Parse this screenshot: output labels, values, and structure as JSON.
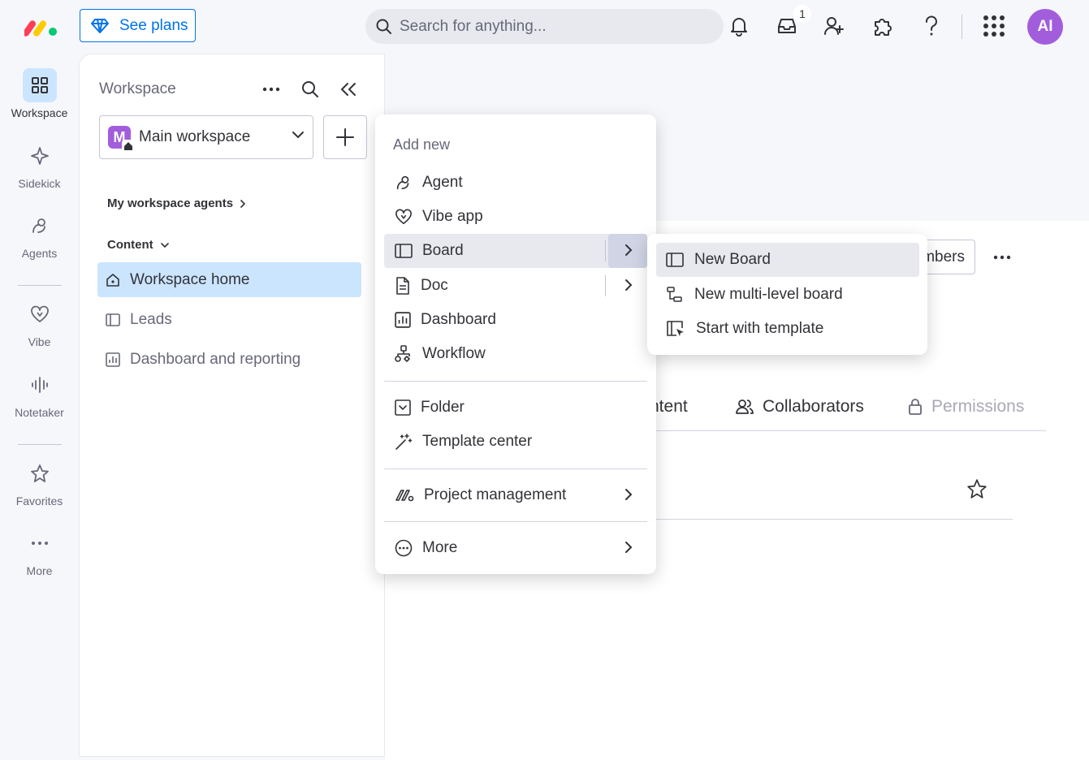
{
  "topbar": {
    "see_plans": "See plans",
    "search_placeholder": "Search for anything...",
    "inbox_badge": "1",
    "avatar_initials": "AI"
  },
  "rail": {
    "items": [
      {
        "label": "Workspace",
        "icon": "grid-icon"
      },
      {
        "label": "Sidekick",
        "icon": "sparkle-icon"
      },
      {
        "label": "Agents",
        "icon": "agent-icon"
      },
      {
        "label": "Vibe",
        "icon": "heart-icon"
      },
      {
        "label": "Notetaker",
        "icon": "waveform-icon"
      },
      {
        "label": "Favorites",
        "icon": "star-icon"
      },
      {
        "label": "More",
        "icon": "dots-icon"
      }
    ]
  },
  "panel": {
    "title": "Workspace",
    "workspace_name": "Main workspace",
    "workspace_initial": "M",
    "agents_link": "My workspace agents",
    "content_label": "Content",
    "items": [
      {
        "label": "Workspace home",
        "icon": "home-icon"
      },
      {
        "label": "Leads",
        "icon": "board-icon"
      },
      {
        "label": "Dashboard and reporting",
        "icon": "dashboard-icon"
      }
    ]
  },
  "main": {
    "members_label": "mbers",
    "tabs": [
      {
        "label": "ntent"
      },
      {
        "label": "Collaborators"
      },
      {
        "label": "Permissions"
      }
    ]
  },
  "menu": {
    "title": "Add new",
    "items": [
      {
        "label": "Agent"
      },
      {
        "label": "Vibe app"
      },
      {
        "label": "Board"
      },
      {
        "label": "Doc"
      },
      {
        "label": "Dashboard"
      },
      {
        "label": "Workflow"
      },
      {
        "label": "Folder"
      },
      {
        "label": "Template center"
      },
      {
        "label": "Project management"
      },
      {
        "label": "More"
      }
    ]
  },
  "submenu": {
    "items": [
      {
        "label": "New Board"
      },
      {
        "label": "New multi-level board"
      },
      {
        "label": "Start with template"
      }
    ]
  }
}
